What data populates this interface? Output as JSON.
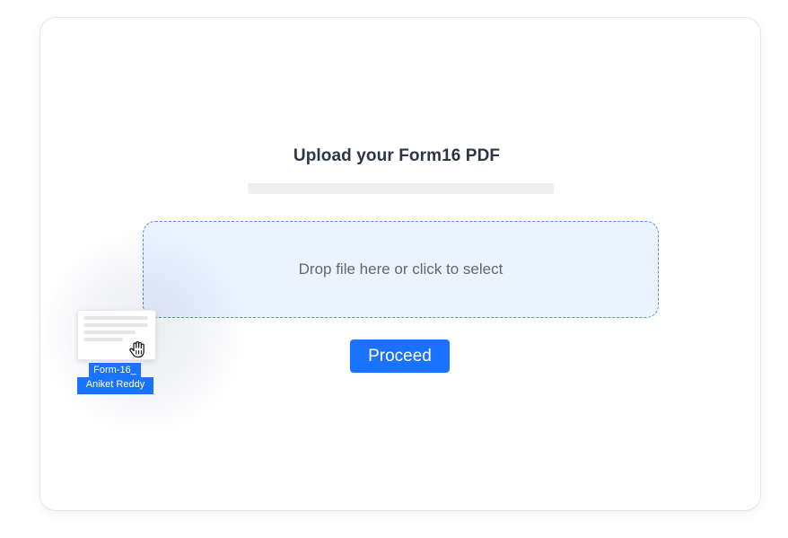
{
  "upload": {
    "title": "Upload your Form16 PDF",
    "progress": 0,
    "dropzone_text": "Drop file here or click to select",
    "proceed_label": "Proceed"
  },
  "dragged_file": {
    "name_line1": "Form-16_",
    "name_line2": "Aniket Reddy",
    "cursor_icon": "grab-hand-icon"
  },
  "colors": {
    "accent": "#1a73ff",
    "dropzone_bg": "#eaf3fe",
    "dropzone_border": "#4d8df0",
    "title": "#2d3645",
    "text_muted": "#5e6876",
    "progress_track": "#efefef"
  }
}
